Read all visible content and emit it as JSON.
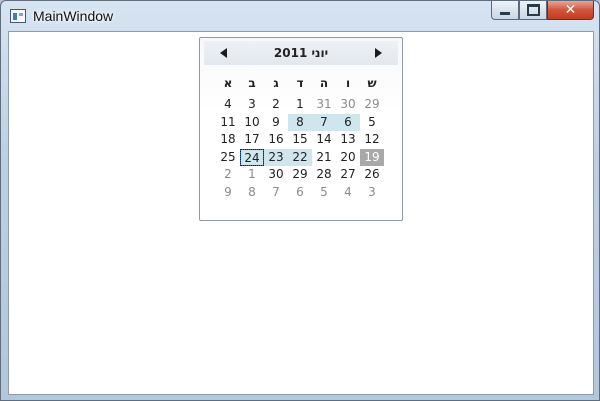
{
  "window": {
    "title": "MainWindow",
    "controls": {
      "minimize": "minimize",
      "maximize": "maximize",
      "close": "✕"
    }
  },
  "calendar": {
    "month_title": "יוני 2011",
    "days_of_week": [
      "ש",
      "ו",
      "ה",
      "ד",
      "ג",
      "ב",
      "א"
    ],
    "weeks": [
      [
        {
          "d": "29",
          "o": true
        },
        {
          "d": "30",
          "o": true
        },
        {
          "d": "31",
          "o": true
        },
        {
          "d": "1"
        },
        {
          "d": "2"
        },
        {
          "d": "3"
        },
        {
          "d": "4"
        }
      ],
      [
        {
          "d": "5"
        },
        {
          "d": "6",
          "s": true
        },
        {
          "d": "7",
          "s": true
        },
        {
          "d": "8",
          "s": true
        },
        {
          "d": "9"
        },
        {
          "d": "10"
        },
        {
          "d": "11"
        }
      ],
      [
        {
          "d": "12"
        },
        {
          "d": "13"
        },
        {
          "d": "14"
        },
        {
          "d": "15"
        },
        {
          "d": "16"
        },
        {
          "d": "17"
        },
        {
          "d": "18"
        }
      ],
      [
        {
          "d": "19",
          "t": true
        },
        {
          "d": "20"
        },
        {
          "d": "21"
        },
        {
          "d": "22",
          "s": true
        },
        {
          "d": "23",
          "s": true
        },
        {
          "d": "24",
          "s": true,
          "f": true
        },
        {
          "d": "25"
        }
      ],
      [
        {
          "d": "26"
        },
        {
          "d": "27"
        },
        {
          "d": "28"
        },
        {
          "d": "29"
        },
        {
          "d": "30"
        },
        {
          "d": "1",
          "o": true
        },
        {
          "d": "2",
          "o": true
        }
      ],
      [
        {
          "d": "3",
          "o": true
        },
        {
          "d": "4",
          "o": true
        },
        {
          "d": "5",
          "o": true
        },
        {
          "d": "6",
          "o": true
        },
        {
          "d": "7",
          "o": true
        },
        {
          "d": "8",
          "o": true
        },
        {
          "d": "9",
          "o": true
        }
      ]
    ]
  },
  "colors": {
    "selected": "#cfe6ee",
    "today": "#a8a8a8",
    "close_button": "#c33b20"
  }
}
